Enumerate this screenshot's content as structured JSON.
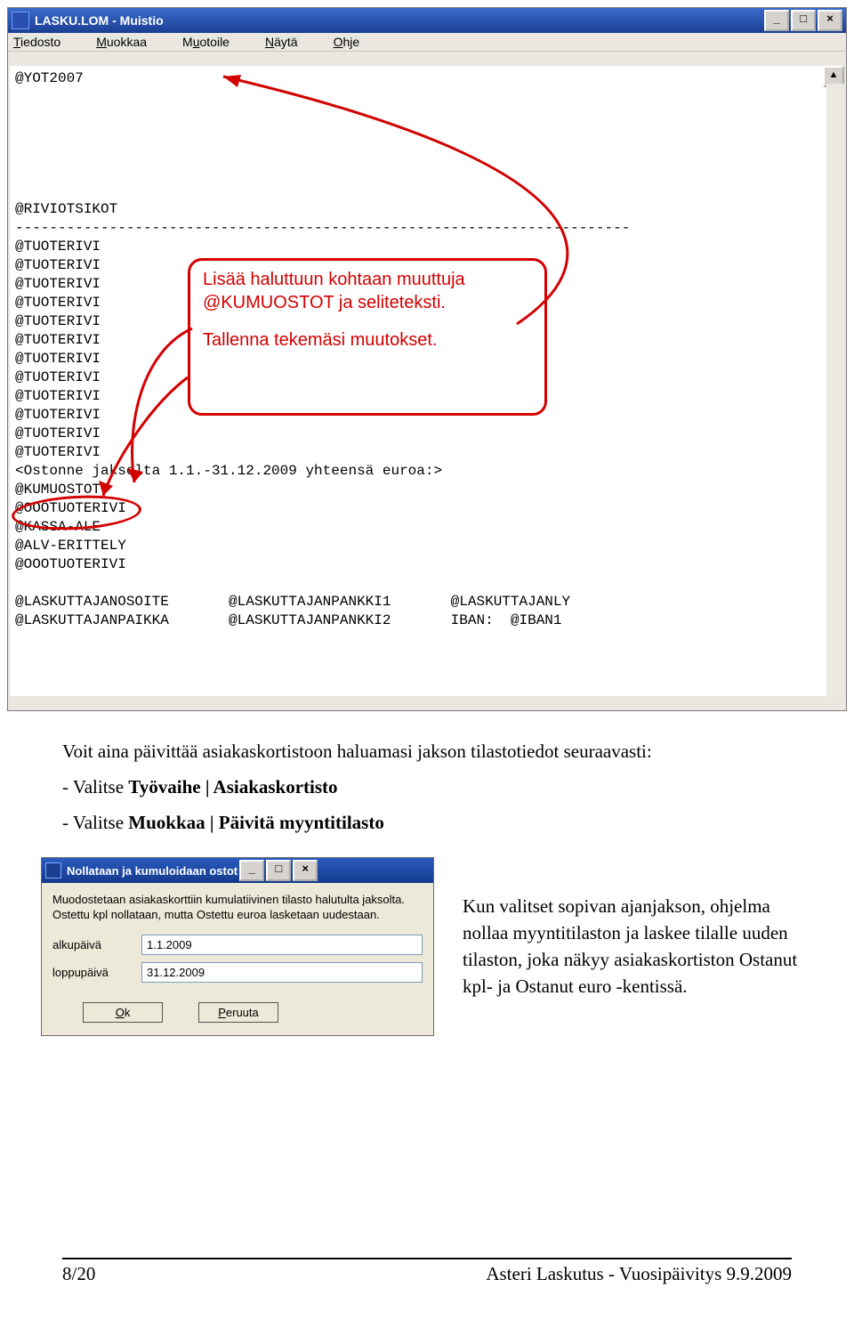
{
  "notepad": {
    "title": "LASKU.LOM - Muistio",
    "menus": [
      "Tiedosto",
      "Muokkaa",
      "Muotoile",
      "Näytä",
      "Ohje"
    ],
    "lines": [
      "@YOT2007",
      "",
      "",
      "",
      "",
      "",
      "",
      "@RIVIOTSIKOT",
      "------------------------------------------------------------------------",
      "@TUOTERIVI",
      "@TUOTERIVI",
      "@TUOTERIVI",
      "@TUOTERIVI",
      "@TUOTERIVI",
      "@TUOTERIVI",
      "@TUOTERIVI",
      "@TUOTERIVI",
      "@TUOTERIVI",
      "@TUOTERIVI",
      "@TUOTERIVI",
      "@TUOTERIVI",
      "<Ostonne jaksolta 1.1.-31.12.2009 yhteensä euroa:>",
      "@KUMUOSTOT",
      "@OOOTUOTERIVI",
      "@KASSA-ALE",
      "@ALV-ERITTELY",
      "@OOOTUOTERIVI",
      "",
      "@LASKUTTAJANOSOITE       @LASKUTTAJANPANKKI1       @LASKUTTAJANLY",
      "@LASKUTTAJANPAIKKA       @LASKUTTAJANPANKKI2       IBAN:  @IBAN1"
    ],
    "annotation": {
      "line1": "Lisää haluttuun kohtaan muuttuja @KUMUOSTOT ja seliteteksti.",
      "line2": "Tallenna tekemäsi muutokset."
    }
  },
  "body": {
    "p1": "Voit aina päivittää asiakaskortistoon haluamasi jakson tilastotiedot seuraavasti:",
    "li1_pre": "- Valitse ",
    "li1_bold": "Työvaihe | Asiakaskortisto",
    "li2_pre": "- Valitse ",
    "li2_bold": "Muokkaa | Päivitä myyntitilasto"
  },
  "dialog": {
    "title": "Nollataan ja kumuloidaan ostot",
    "desc": "Muodostetaan asiakaskorttiin kumulatiivinen tilasto halutulta jaksolta. Ostettu kpl nollataan, mutta Ostettu euroa lasketaan uudestaan.",
    "alkupaiva_label": "alkupäivä",
    "alkupaiva_value": "1.1.2009",
    "loppupaiva_label": "loppupäivä",
    "loppupaiva_value": "31.12.2009",
    "ok": "Ok",
    "cancel": "Peruuta"
  },
  "sidenote": "Kun valitset sopivan ajanjakson, ohjelma nollaa myyntitilaston ja laskee tilalle uuden tilaston, joka näkyy asiakaskortiston Ostanut kpl- ja Ostanut euro -kentissä.",
  "footer": {
    "left": "8/20",
    "right": "Asteri Laskutus - Vuosipäivitys 9.9.2009"
  }
}
